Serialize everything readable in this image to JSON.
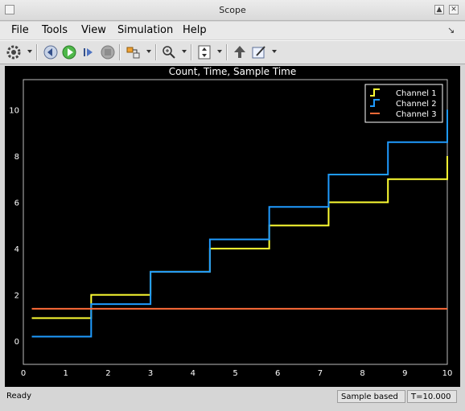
{
  "window": {
    "title": "Scope"
  },
  "menu": {
    "items": [
      "File",
      "Tools",
      "View",
      "Simulation",
      "Help"
    ]
  },
  "toolbar": {
    "buttons": [
      "configuration-properties",
      "step-back",
      "run",
      "step-forward",
      "stop",
      "signal-selection",
      "zoom",
      "scale-axes",
      "highlight-simulink-block",
      "style"
    ]
  },
  "status": {
    "ready": "Ready",
    "mode": "Sample based",
    "time": "T=10.000"
  },
  "colors": {
    "channel1": "#ffff33",
    "channel2": "#1f9bff",
    "channel3": "#ff6b38",
    "grid": "#5a5a5a",
    "background": "#000000"
  },
  "chart_data": {
    "type": "line",
    "title": "Count, Time, Sample Time",
    "xlabel": "",
    "ylabel": "",
    "xlim": [
      0,
      10
    ],
    "ylim": [
      -1,
      11.3
    ],
    "x_ticks": [
      0,
      1,
      2,
      3,
      4,
      5,
      6,
      7,
      8,
      9,
      10
    ],
    "y_ticks": [
      0,
      2,
      4,
      6,
      8,
      10
    ],
    "grid": true,
    "legend_position": "top-right",
    "series": [
      {
        "name": "Channel 1",
        "step": true,
        "x": [
          0.2,
          1.6,
          3.0,
          4.4,
          5.8,
          7.2,
          8.6,
          10.0
        ],
        "y": [
          1,
          2,
          3,
          4,
          5,
          6,
          7,
          8
        ]
      },
      {
        "name": "Channel 2",
        "step": true,
        "x": [
          0.2,
          1.6,
          3.0,
          4.4,
          5.8,
          7.2,
          8.6,
          10.0
        ],
        "y": [
          0.2,
          1.6,
          3.0,
          4.4,
          5.8,
          7.2,
          8.6,
          10.0
        ]
      },
      {
        "name": "Channel 3",
        "step": false,
        "x": [
          0.2,
          10.0
        ],
        "y": [
          1.4,
          1.4
        ]
      }
    ]
  }
}
